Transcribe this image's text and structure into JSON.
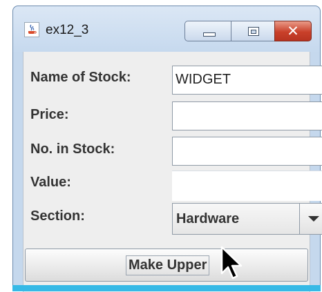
{
  "window": {
    "title": "ex12_3",
    "icon": "java-cup-icon",
    "controls": [
      "minimize-icon",
      "maximize-icon",
      "close-icon"
    ]
  },
  "form": {
    "fields": [
      {
        "label": "Name of Stock:",
        "value": "WIDGET"
      },
      {
        "label": "Price:",
        "value": ""
      },
      {
        "label": "No. in Stock:",
        "value": ""
      },
      {
        "label": "Value:",
        "value": ""
      }
    ],
    "section": {
      "label": "Section:",
      "selected": "Hardware"
    }
  },
  "button": {
    "label": "Make Upper"
  },
  "colors": {
    "titlebar": "#c5d8ed",
    "close_button": "#c9402a",
    "panel": "#eeeeee",
    "accent_bar": "#36b9e6"
  }
}
